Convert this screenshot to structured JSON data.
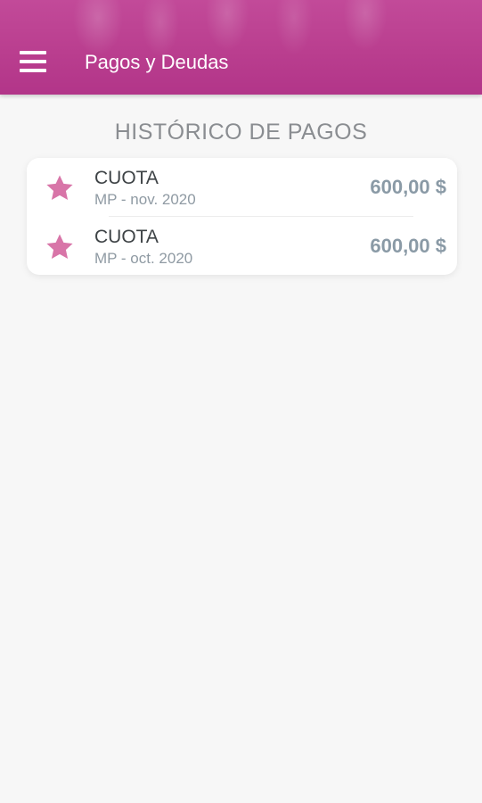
{
  "app_bar": {
    "title": "Pagos y Deudas",
    "menu_icon": "menu-icon",
    "color": "#b93d8e"
  },
  "section": {
    "title": "HISTÓRICO DE PAGOS"
  },
  "payments": [
    {
      "icon": "star-icon",
      "title": "CUOTA",
      "subtitle": "MP - nov. 2020",
      "amount": "600,00 $"
    },
    {
      "icon": "star-icon",
      "title": "CUOTA",
      "subtitle": "MP - oct. 2020",
      "amount": "600,00 $"
    }
  ],
  "colors": {
    "accent": "#d875a8",
    "header": "#b93d8e",
    "amount": "#8a9aa6"
  }
}
